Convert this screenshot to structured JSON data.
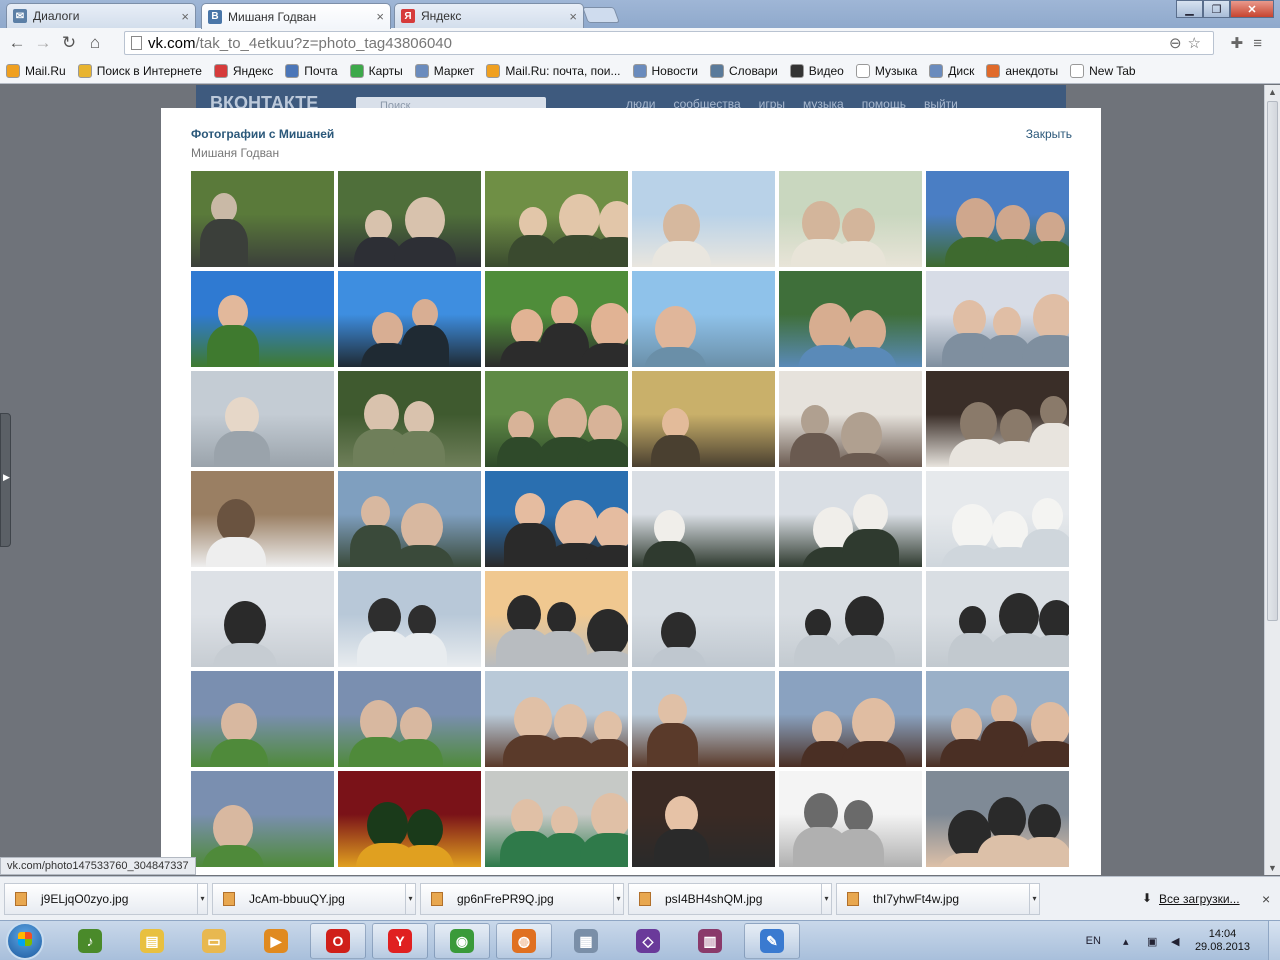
{
  "browser": {
    "tabs": [
      {
        "title": "Диалоги",
        "icon": "vk-mail-icon",
        "color": "#5b7fa6"
      },
      {
        "title": "Мишаня Годван",
        "icon": "vk-icon",
        "color": "#4a76a8"
      },
      {
        "title": "Яндекс",
        "icon": "yandex-icon",
        "color": "#d63b3b"
      }
    ],
    "url_host": "vk.com",
    "url_path": "/tak_to_4etkuu?z=photo_tag43806040",
    "bookmarks": [
      {
        "label": "Mail.Ru",
        "color": "#f0a020"
      },
      {
        "label": "Поиск в Интернете",
        "color": "#e8b430"
      },
      {
        "label": "Яндекс",
        "color": "#d63b3b"
      },
      {
        "label": "Почта",
        "color": "#4b76b8"
      },
      {
        "label": "Карты",
        "color": "#3da84a"
      },
      {
        "label": "Маркет",
        "color": "#6a8bbd"
      },
      {
        "label": "Mail.Ru: почта, пои...",
        "color": "#f0a020"
      },
      {
        "label": "Новости",
        "color": "#6a8bbd"
      },
      {
        "label": "Словари",
        "color": "#5a7a9a"
      },
      {
        "label": "Видео",
        "color": "#333333"
      },
      {
        "label": "Музыка",
        "color": "#ffffff"
      },
      {
        "label": "Диск",
        "color": "#6a8bbd"
      },
      {
        "label": "анекдоты",
        "color": "#e06a2a"
      },
      {
        "label": "New Tab",
        "color": "#ffffff"
      }
    ]
  },
  "vk_header": {
    "logo": "ВКОНТАКТЕ",
    "search_placeholder": "Поиск",
    "nav": [
      "люди",
      "сообщества",
      "игры",
      "музыка",
      "помощь",
      "выйти"
    ]
  },
  "modal": {
    "title": "Фотографии с Мишаней",
    "subtitle": "Мишаня Годван",
    "close_label": "Закрыть",
    "photos": [
      [
        "#5a7a3a",
        "#3b3f3a",
        "#c9b9a6"
      ],
      [
        "#4f6f3a",
        "#2d2f35",
        "#d8c2ad"
      ],
      [
        "#6f8f45",
        "#3a4a2f",
        "#e2c6a9"
      ],
      [
        "#b9d2e8",
        "#e9e6df",
        "#d6b89e"
      ],
      [
        "#c9d7bf",
        "#e8e4d8",
        "#d3b59b"
      ],
      [
        "#4a7ec4",
        "#3e6a2f",
        "#cfa78d"
      ],
      [
        "#2f7ad2",
        "#3f7a2f",
        "#e2b89b"
      ],
      [
        "#3e8ee0",
        "#1f2a33",
        "#d8ae93"
      ],
      [
        "#4f8d3a",
        "#2c2c2c",
        "#e1b394"
      ],
      [
        "#8fc2ea",
        "#6a8fa8",
        "#e0b69a"
      ],
      [
        "#3f6f3a",
        "#5a8ab8",
        "#d7ad90"
      ],
      [
        "#d7dce6",
        "#7f8f9f",
        "#e0bea5"
      ],
      [
        "#c4ccd4",
        "#9aa3ab",
        "#e6d7c8"
      ],
      [
        "#3f5a2f",
        "#6f7f5a",
        "#d9c2ad"
      ],
      [
        "#5f8a45",
        "#2f4a2a",
        "#d8b398"
      ],
      [
        "#c9b06a",
        "#4a4030",
        "#e3bb9a"
      ],
      [
        "#e6e2dc",
        "#6a5a50",
        "#b0a090"
      ],
      [
        "#3a2e28",
        "#e8e4de",
        "#8a7a6a"
      ],
      [
        "#9a7f63",
        "#eeeeee",
        "#6a5340"
      ],
      [
        "#7f9fbf",
        "#3a4a3a",
        "#d8b8a0"
      ],
      [
        "#2a6fb0",
        "#2a2a2a",
        "#e5bca0"
      ],
      [
        "#d9dee4",
        "#2f3a2f",
        "#f0eeea"
      ],
      [
        "#d9dee4",
        "#2f3a2f",
        "#f0eeea"
      ],
      [
        "#e6e9ec",
        "#cfd6dc",
        "#f4f4f2"
      ],
      [
        "#dde1e6",
        "#c6ccd2",
        "#2a2a2a"
      ],
      [
        "#b8c8d8",
        "#e8ecef",
        "#2e2e2e"
      ],
      [
        "#f0c890",
        "#b8bcc0",
        "#2a2a2a"
      ],
      [
        "#d6dce2",
        "#bfc7cf",
        "#2c2c2c"
      ],
      [
        "#d8dde2",
        "#c3cad0",
        "#2a2a2a"
      ],
      [
        "#d9dee3",
        "#c2c9cf",
        "#2b2b2b"
      ],
      [
        "#7a8fb0",
        "#4f8a3a",
        "#d8b8a0"
      ],
      [
        "#7a8fb0",
        "#4f8a3a",
        "#d8b8a0"
      ],
      [
        "#b9c9d8",
        "#5a3a2a",
        "#e0c0a6"
      ],
      [
        "#b9c9d8",
        "#5a3a2a",
        "#e0c0a6"
      ],
      [
        "#8aa2c0",
        "#4a2f24",
        "#e0bda2"
      ],
      [
        "#9ab0c8",
        "#4a2f24",
        "#dfbba0"
      ],
      [
        "#7a8fb0",
        "#4f8a3a",
        "#d8b8a0"
      ],
      [
        "#7a1218",
        "#e0a020",
        "#1a3a1a"
      ],
      [
        "#c6c9c6",
        "#2f7a4a",
        "#e0c0a6"
      ],
      [
        "#3a2a24",
        "#2a2a2a",
        "#e6c2a6"
      ],
      [
        "#f4f4f4",
        "#b0b0b0",
        "#6a6a6a"
      ],
      [
        "#7f8a96",
        "#dcc0a8",
        "#2a2a2a"
      ]
    ]
  },
  "status_url": "vk.com/photo147533760_304847337",
  "downloads": {
    "items": [
      "j9ELjqO0zyo.jpg",
      "JcAm-bbuuQY.jpg",
      "gp6nFrePR9Q.jpg",
      "psI4BH4shQM.jpg",
      "thI7yhwFt4w.jpg"
    ],
    "all_label": "Все загрузки..."
  },
  "taskbar": {
    "apps": [
      {
        "name": "media-player-icon",
        "color": "#4a8a2a",
        "glyph": "♪"
      },
      {
        "name": "notes-icon",
        "color": "#e8c040",
        "glyph": "▤"
      },
      {
        "name": "folder-icon",
        "color": "#e8b850",
        "glyph": "▭"
      },
      {
        "name": "video-player-icon",
        "color": "#e08a20",
        "glyph": "▶"
      },
      {
        "name": "opera-icon",
        "color": "#d0201a",
        "glyph": "O"
      },
      {
        "name": "yandex-browser-icon",
        "color": "#e02020",
        "glyph": "Y"
      },
      {
        "name": "chrome-icon",
        "color": "#3a9a3a",
        "glyph": "◉"
      },
      {
        "name": "firefox-icon",
        "color": "#e07020",
        "glyph": "◍"
      },
      {
        "name": "calculator-icon",
        "color": "#7a8fa8",
        "glyph": "▦"
      },
      {
        "name": "visual-studio-icon",
        "color": "#6a3a9a",
        "glyph": "◇"
      },
      {
        "name": "winrar-icon",
        "color": "#8a3a6a",
        "glyph": "▥"
      },
      {
        "name": "paint-icon",
        "color": "#3a7ad0",
        "glyph": "✎"
      }
    ],
    "language": "EN",
    "time": "14:04",
    "date": "29.08.2013"
  }
}
